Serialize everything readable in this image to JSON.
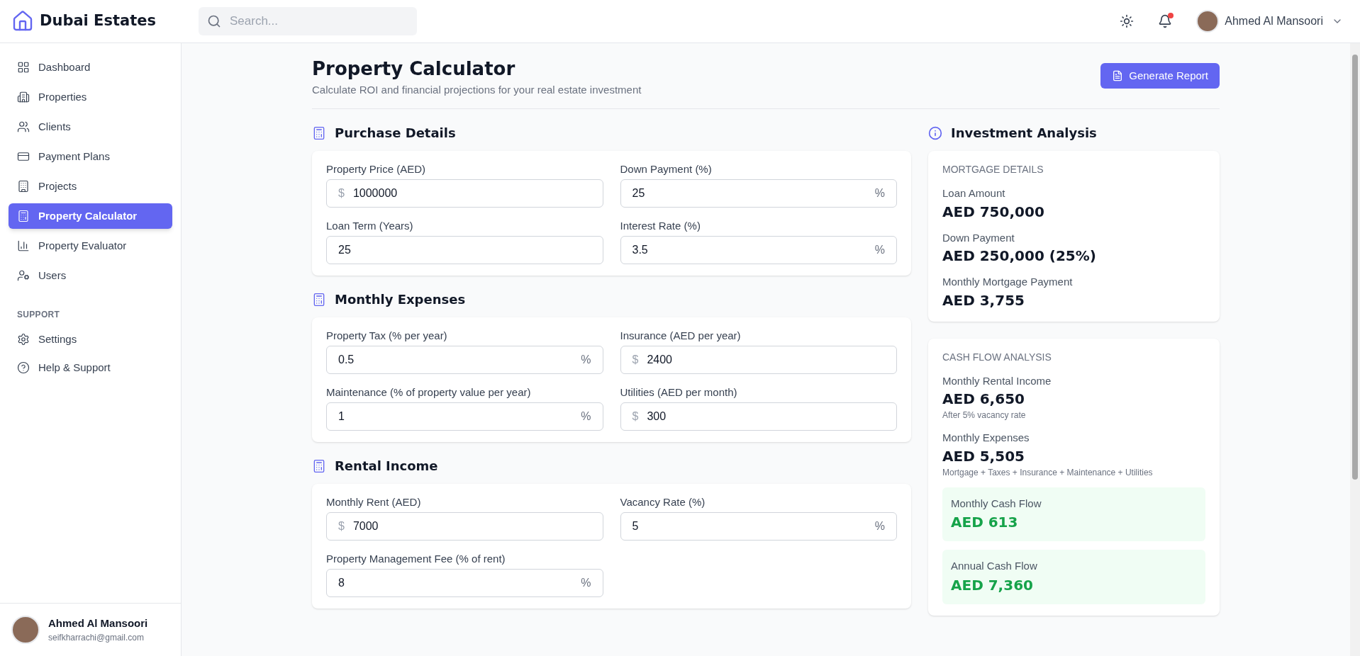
{
  "brand": {
    "name": "Dubai Estates"
  },
  "search": {
    "placeholder": "Search..."
  },
  "header": {
    "notification_dot": true,
    "user_name": "Ahmed Al Mansoori"
  },
  "sidebar": {
    "items": [
      {
        "label": "Dashboard",
        "kind": "dashboard",
        "selected": false
      },
      {
        "label": "Properties",
        "kind": "building",
        "selected": false
      },
      {
        "label": "Clients",
        "kind": "users",
        "selected": false
      },
      {
        "label": "Payment Plans",
        "kind": "card",
        "selected": false
      },
      {
        "label": "Projects",
        "kind": "office",
        "selected": false
      },
      {
        "label": "Property Calculator",
        "kind": "calculator",
        "selected": true
      },
      {
        "label": "Property Evaluator",
        "kind": "chart",
        "selected": false
      },
      {
        "label": "Users",
        "kind": "usercog",
        "selected": false
      }
    ],
    "support_heading": "SUPPORT",
    "support_items": [
      {
        "label": "Settings",
        "kind": "settings",
        "selected": false
      },
      {
        "label": "Help & Support",
        "kind": "help",
        "selected": false
      }
    ],
    "user": {
      "name": "Ahmed Al Mansoori",
      "email": "seifkharrachi@gmail.com"
    }
  },
  "page": {
    "title": "Property Calculator",
    "subtitle": "Calculate ROI and financial projections for your real estate investment",
    "action": "Generate Report"
  },
  "sections": [
    {
      "title": "Purchase Details",
      "fields": [
        {
          "label": "Property Price (AED)",
          "value": "1000000",
          "kind": "prefix",
          "affix": "$"
        },
        {
          "label": "Down Payment (%)",
          "value": "25",
          "kind": "suffix",
          "affix": "%"
        },
        {
          "label": "Loan Term (Years)",
          "value": "25",
          "kind": "plain"
        },
        {
          "label": "Interest Rate (%)",
          "value": "3.5",
          "kind": "suffix",
          "affix": "%"
        }
      ]
    },
    {
      "title": "Monthly Expenses",
      "fields": [
        {
          "label": "Property Tax (% per year)",
          "value": "0.5",
          "kind": "suffix",
          "affix": "%"
        },
        {
          "label": "Insurance (AED per year)",
          "value": "2400",
          "kind": "prefix",
          "affix": "$"
        },
        {
          "label": "Maintenance (% of property value per year)",
          "value": "1",
          "kind": "suffix",
          "affix": "%"
        },
        {
          "label": "Utilities (AED per month)",
          "value": "300",
          "kind": "prefix",
          "affix": "$"
        }
      ]
    },
    {
      "title": "Rental Income",
      "fields": [
        {
          "label": "Monthly Rent (AED)",
          "value": "7000",
          "kind": "prefix",
          "affix": "$"
        },
        {
          "label": "Vacancy Rate (%)",
          "value": "5",
          "kind": "suffix",
          "affix": "%"
        },
        {
          "label": "Property Management Fee (% of rent)",
          "value": "8",
          "kind": "suffix",
          "affix": "%"
        }
      ]
    }
  ],
  "analysis": {
    "title": "Investment Analysis",
    "cards": [
      {
        "heading": "MORTGAGE DETAILS",
        "items": [
          {
            "kind": "stat",
            "label": "Loan Amount",
            "value": "AED 750,000"
          },
          {
            "kind": "stat",
            "label": "Down Payment",
            "value": "AED 250,000 (25%)"
          },
          {
            "kind": "stat",
            "label": "Monthly Mortgage Payment",
            "value": "AED 3,755"
          }
        ]
      },
      {
        "heading": "CASH FLOW ANALYSIS",
        "items": [
          {
            "kind": "stat",
            "label": "Monthly Rental Income",
            "value": "AED 6,650",
            "note": "After 5% vacancy rate"
          },
          {
            "kind": "stat",
            "label": "Monthly Expenses",
            "value": "AED 5,505",
            "note": "Mortgage + Taxes + Insurance + Maintenance + Utilities"
          },
          {
            "kind": "highlight",
            "label": "Monthly Cash Flow",
            "value": "AED 613"
          },
          {
            "kind": "highlight",
            "label": "Annual Cash Flow",
            "value": "AED 7,360"
          }
        ]
      }
    ]
  }
}
